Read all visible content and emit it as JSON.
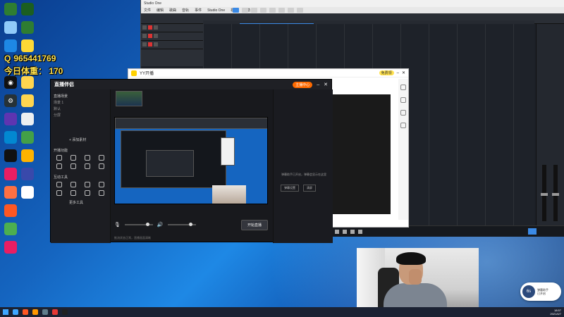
{
  "desktop": {
    "overlay": {
      "qq_prefix": "Q",
      "qq_number": "965441769",
      "weight_line": "今日体重：  170"
    }
  },
  "daw": {
    "title": "Studio One",
    "menu": [
      "文件",
      "编辑",
      "歌曲",
      "音轨",
      "事件",
      "Studio One",
      "视图",
      "帮助"
    ]
  },
  "yy": {
    "title": "YY开播",
    "badge": "免费领"
  },
  "huya": {
    "brand": "直播伴侣",
    "live_button": "主播中心",
    "left_sections": {
      "scene": "直播场景",
      "tools": "开播功能",
      "interactive": "互动工具",
      "add_scene": "+ 添加素材",
      "more_tools": "更多工具"
    },
    "scenes": [
      "场景 1",
      "默认",
      "分屏"
    ],
    "start_button": "开始直播",
    "status_text": "推流状态正常，直播画面清晰",
    "chat_message": "弹幕助手已开启，弹幕会显示在这里",
    "chat_buttons": [
      "弹幕设置",
      "清屏"
    ]
  },
  "widget": {
    "circle_label": "6s",
    "line1": "弹幕助手",
    "line2": "已开启"
  },
  "taskbar": {
    "time": "18:57",
    "date": "2021/4/7"
  },
  "colors": {
    "overlay_yellow": "#ffe14d",
    "huya_orange": "#ff6a00",
    "daw_blue": "#3b8ae6"
  }
}
